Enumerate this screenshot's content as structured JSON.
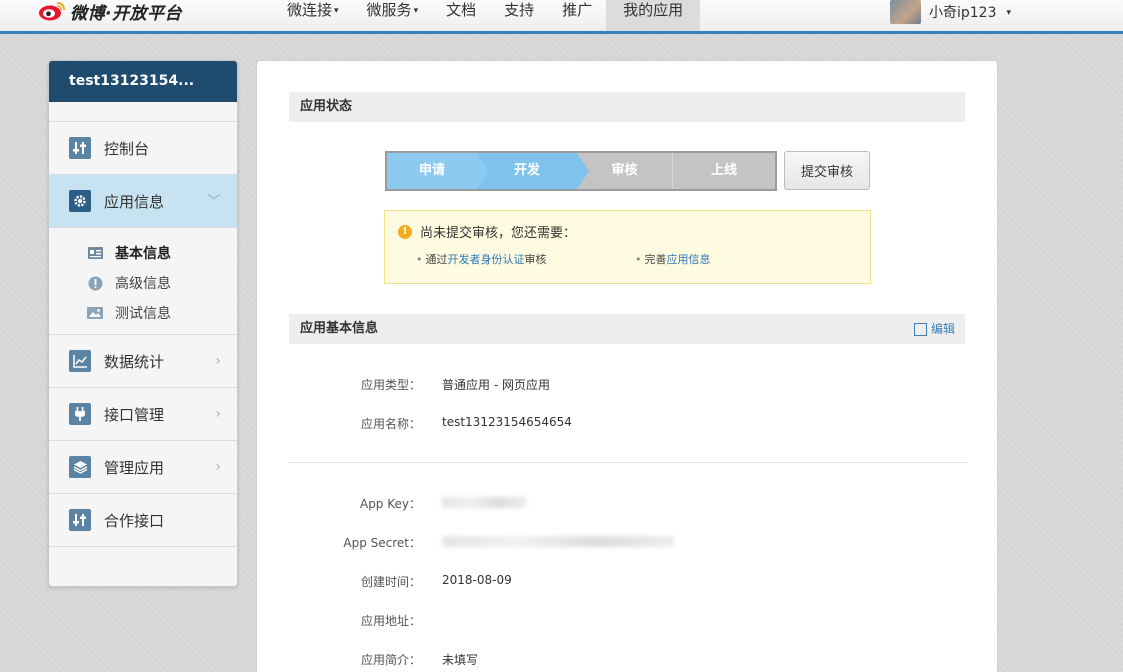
{
  "header": {
    "logo_text": "微博·开放平台",
    "nav": [
      {
        "label": "微连接",
        "caret": true
      },
      {
        "label": "微服务",
        "caret": true
      },
      {
        "label": "文档",
        "caret": false
      },
      {
        "label": "支持",
        "caret": false
      },
      {
        "label": "推广",
        "caret": false
      },
      {
        "label": "我的应用",
        "caret": false,
        "active": true
      }
    ],
    "username": "小奇ip123",
    "caret": "▾"
  },
  "sidebar": {
    "app_title": "test13123154...",
    "items": [
      {
        "label": "控制台",
        "icon": "console-icon"
      },
      {
        "label": "应用信息",
        "icon": "gear-icon",
        "active": true,
        "chevron": "﹀"
      },
      {
        "label": "数据统计",
        "icon": "chart-icon",
        "chevron": "›"
      },
      {
        "label": "接口管理",
        "icon": "plug-icon",
        "chevron": "›"
      },
      {
        "label": "管理应用",
        "icon": "layers-icon",
        "chevron": "›"
      },
      {
        "label": "合作接口",
        "icon": "console-icon"
      }
    ],
    "subitems": [
      {
        "label": "基本信息",
        "icon": "card-icon",
        "active": true
      },
      {
        "label": "高级信息",
        "icon": "info-icon"
      },
      {
        "label": "测试信息",
        "icon": "image-icon"
      }
    ]
  },
  "status_section": {
    "title": "应用状态",
    "steps": [
      {
        "label": "申请",
        "state": "done"
      },
      {
        "label": "开发",
        "state": "current"
      },
      {
        "label": "审核",
        "state": "todo"
      },
      {
        "label": "上线",
        "state": "todo"
      }
    ],
    "submit_label": "提交审核"
  },
  "notice": {
    "title": "尚未提交审核，您还需要：",
    "item1_prefix": "通过",
    "item1_link": "开发者身份认证",
    "item1_suffix": "审核",
    "item2_prefix": "完善",
    "item2_link": "应用信息",
    "bullet": "•",
    "warn_glyph": "!"
  },
  "basic_section": {
    "title": "应用基本信息",
    "edit_label": "编辑",
    "rows": [
      {
        "label": "应用类型：",
        "value": "普通应用 - 网页应用"
      },
      {
        "label": "应用名称：",
        "value": "test13123154654654"
      },
      {
        "label": "App Key：",
        "value": ""
      },
      {
        "label": "App Secret：",
        "value": ""
      },
      {
        "label": "创建时间：",
        "value": "2018-08-09"
      },
      {
        "label": "应用地址：",
        "value": ""
      },
      {
        "label": "应用简介：",
        "value": "未填写"
      }
    ]
  },
  "colors": {
    "accent": "#3a7fb8",
    "sidebar_header": "#1f4c6e",
    "step_active": "#8ccaf0",
    "step_inactive": "#c4c4c4",
    "link": "#2e78b8",
    "warning": "#f0ad20"
  }
}
